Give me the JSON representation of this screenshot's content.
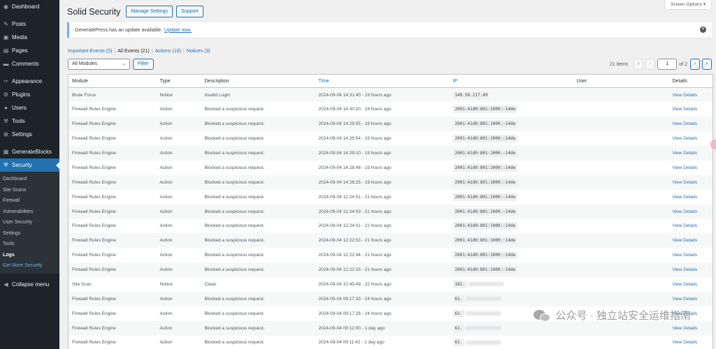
{
  "sidebar": {
    "menu": [
      {
        "label": "Dashboard",
        "icon": "dashboard-icon",
        "glyph": "◉"
      },
      {
        "sep": true
      },
      {
        "label": "Posts",
        "icon": "pin-icon",
        "glyph": "✎"
      },
      {
        "label": "Media",
        "icon": "media-icon",
        "glyph": "▣"
      },
      {
        "label": "Pages",
        "icon": "pages-icon",
        "glyph": "▤"
      },
      {
        "label": "Comments",
        "icon": "comments-icon",
        "glyph": "▬"
      },
      {
        "sep": true
      },
      {
        "label": "Appearance",
        "icon": "brush-icon",
        "glyph": "✑"
      },
      {
        "label": "Plugins",
        "icon": "plugin-icon",
        "glyph": "⚙"
      },
      {
        "label": "Users",
        "icon": "users-icon",
        "glyph": "●"
      },
      {
        "label": "Tools",
        "icon": "wrench-icon",
        "glyph": "⚒"
      },
      {
        "label": "Settings",
        "icon": "settings-icon",
        "glyph": "⊞"
      },
      {
        "sep": true
      },
      {
        "label": "GenerateBlocks",
        "icon": "blocks-icon",
        "glyph": "▦"
      },
      {
        "label": "Security",
        "icon": "shield-icon",
        "glyph": "⛨",
        "current": true
      }
    ],
    "submenu": [
      {
        "label": "Dashboard"
      },
      {
        "label": "Site Scans"
      },
      {
        "label": "Firewall"
      },
      {
        "label": "Vulnerabilities"
      },
      {
        "label": "User Security"
      },
      {
        "label": "Settings"
      },
      {
        "label": "Tools"
      },
      {
        "label": "Logs",
        "active": true
      },
      {
        "label": "Get More Security",
        "highlight": true
      }
    ],
    "collapse_label": "Collapse menu"
  },
  "header": {
    "screen_options": "Screen Options ▾",
    "title": "Solid Security",
    "manage_settings": "Manage Settings",
    "support": "Support"
  },
  "notice": {
    "text": "GeneratePress has an update available.",
    "link": "Update now."
  },
  "views": [
    {
      "label": "Important Events (0)",
      "current": false
    },
    {
      "label": "All Events (21)",
      "current": true
    },
    {
      "label": "Actions (18)",
      "current": false
    },
    {
      "label": "Notices (3)",
      "current": false
    }
  ],
  "filters": {
    "module_select": "All Modules",
    "filter_button": "Filter"
  },
  "pagination": {
    "count": "21 items",
    "first": "«",
    "prev": "‹",
    "current_page": "1",
    "of": "of 2",
    "next": "›",
    "last": "»"
  },
  "table": {
    "columns": [
      {
        "label": "Module",
        "sortable": false
      },
      {
        "label": "Type",
        "sortable": false
      },
      {
        "label": "Description",
        "sortable": false
      },
      {
        "label": "Time",
        "sortable": true
      },
      {
        "label": "IP",
        "sortable": true
      },
      {
        "label": "User",
        "sortable": false
      },
      {
        "label": "Details",
        "sortable": false
      }
    ],
    "rows": [
      {
        "module": "Brute Force",
        "type": "Notice",
        "description": "Invalid Login",
        "time": "2024-09-04 14:31:40 - 19 hours ago",
        "ip": "149.50.217.49",
        "user": "",
        "details": "View Details"
      },
      {
        "module": "Firewall Rules Engine",
        "type": "Action",
        "description": "Blocked a suspicious request.",
        "time": "2024-09-04 14:30:20 - 19 hours ago",
        "ip": "2001:41d0:801:1000::14de",
        "user": "",
        "details": "View Details"
      },
      {
        "module": "Firewall Rules Engine",
        "type": "Action",
        "description": "Blocked a suspicious request.",
        "time": "2024-09-04 14:29:55 - 19 hours ago",
        "ip": "2001:41d0:801:1000::14de",
        "user": "",
        "details": "View Details"
      },
      {
        "module": "Firewall Rules Engine",
        "type": "Action",
        "description": "Blocked a suspicious request.",
        "time": "2024-09-04 14:29:54 - 19 hours ago",
        "ip": "2001:41d0:801:1000::14de",
        "user": "",
        "details": "View Details"
      },
      {
        "module": "Firewall Rules Engine",
        "type": "Action",
        "description": "Blocked a suspicious request.",
        "time": "2024-09-04 14:29:10 - 19 hours ago",
        "ip": "2001:41d0:801:1000::14de",
        "user": "",
        "details": "View Details"
      },
      {
        "module": "Firewall Rules Engine",
        "type": "Action",
        "description": "Blocked a suspicious request.",
        "time": "2024-09-04 14:28:48 - 19 hours ago",
        "ip": "2001:41d0:801:1000::14de",
        "user": "",
        "details": "View Details"
      },
      {
        "module": "Firewall Rules Engine",
        "type": "Action",
        "description": "Blocked a suspicious request.",
        "time": "2024-09-04 14:28:25 - 19 hours ago",
        "ip": "2001:41d0:801:1000::14de",
        "user": "",
        "details": "View Details"
      },
      {
        "module": "Firewall Rules Engine",
        "type": "Action",
        "description": "Blocked a suspicious request.",
        "time": "2024-09-04 12:24:51 - 21 hours ago",
        "ip": "2001:41d0:801:1000::14de",
        "user": "",
        "details": "View Details"
      },
      {
        "module": "Firewall Rules Engine",
        "type": "Action",
        "description": "Blocked a suspicious request.",
        "time": "2024-09-04 12:24:03 - 21 hours ago",
        "ip": "2001:41d0:801:1000::14de",
        "user": "",
        "details": "View Details"
      },
      {
        "module": "Firewall Rules Engine",
        "type": "Action",
        "description": "Blocked a suspicious request.",
        "time": "2024-09-04 12:24:01 - 21 hours ago",
        "ip": "2001:41d0:801:1000::14de",
        "user": "",
        "details": "View Details"
      },
      {
        "module": "Firewall Rules Engine",
        "type": "Action",
        "description": "Blocked a suspicious request.",
        "time": "2024-09-04 12:22:53 - 21 hours ago",
        "ip": "2001:41d0:801:1000::14de",
        "user": "",
        "details": "View Details"
      },
      {
        "module": "Firewall Rules Engine",
        "type": "Action",
        "description": "Blocked a suspicious request.",
        "time": "2024-09-04 12:22:44 - 21 hours ago",
        "ip": "2001:41d0:801:1000::14de",
        "user": "",
        "details": "View Details"
      },
      {
        "module": "Firewall Rules Engine",
        "type": "Action",
        "description": "Blocked a suspicious request.",
        "time": "2024-09-04 12:22:15 - 21 hours ago",
        "ip": "2001:41d0:801:1000::14de",
        "user": "",
        "details": "View Details"
      },
      {
        "module": "Site Scan",
        "type": "Notice",
        "description": "Clean",
        "time": "2024-09-04 10:45:49 - 22 hours ago",
        "ip": "182.",
        "ip_blurred": true,
        "user": "",
        "details": "View Details"
      },
      {
        "module": "Firewall Rules Engine",
        "type": "Action",
        "description": "Blocked a suspicious request.",
        "time": "2024-09-04 09:17:33 - 24 hours ago",
        "ip": "61.",
        "ip_blurred": true,
        "user": "",
        "details": "View Details"
      },
      {
        "module": "Firewall Rules Engine",
        "type": "Action",
        "description": "Blocked a suspicious request.",
        "time": "2024-09-04 09:17:28 - 24 hours ago",
        "ip": "61.",
        "ip_blurred": true,
        "user": "",
        "details": "View Details"
      },
      {
        "module": "Firewall Rules Engine",
        "type": "Action",
        "description": "Blocked a suspicious request.",
        "time": "2024-09-04 09:12:00 - 1 day ago",
        "ip": "61.",
        "ip_blurred": true,
        "user": "",
        "details": "View Details"
      },
      {
        "module": "Firewall Rules Engine",
        "type": "Action",
        "description": "Blocked a suspicious request.",
        "time": "2024-09-04 09:11:42 - 1 day ago",
        "ip": "61.",
        "ip_blurred": true,
        "user": "",
        "details": "View Details"
      }
    ]
  },
  "watermark": {
    "text": "公众号 · 独立站安全运维指南",
    "icon": "wechat-icon"
  },
  "colors": {
    "accent": "#2271b1",
    "sidebar_bg": "#1d2327",
    "current_menu": "#2271b1"
  }
}
